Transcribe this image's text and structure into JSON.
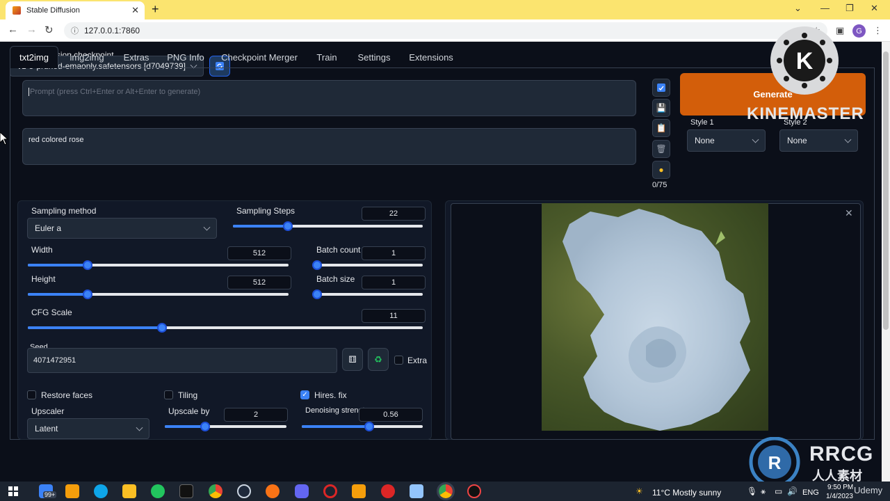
{
  "browser": {
    "tab_title": "Stable Diffusion",
    "url": "127.0.0.1:7860",
    "profile_initial": "G"
  },
  "checkpoint": {
    "label": "Stable Diffusion checkpoint",
    "value": "v1-5-pruned-emaonly.safetensors [d7049739]"
  },
  "tabs": [
    {
      "label": "txt2img",
      "active": true
    },
    {
      "label": "img2img"
    },
    {
      "label": "Extras"
    },
    {
      "label": "PNG Info"
    },
    {
      "label": "Checkpoint Merger"
    },
    {
      "label": "Train"
    },
    {
      "label": "Settings"
    },
    {
      "label": "Extensions"
    }
  ],
  "prompt": {
    "placeholder": "Prompt (press Ctrl+Enter or Alt+Enter to generate)",
    "negative_value": "red colored rose",
    "token_count": "0/75"
  },
  "generate_label": "Generate",
  "styles": {
    "style1_label": "Style 1",
    "style1_value": "None",
    "style2_label": "Style 2",
    "style2_value": "None"
  },
  "settings": {
    "sampling_method_label": "Sampling method",
    "sampling_method_value": "Euler a",
    "sampling_steps_label": "Sampling Steps",
    "sampling_steps_value": "22",
    "sampling_steps_fraction": 0.29,
    "width_label": "Width",
    "width_value": "512",
    "width_fraction": 0.23,
    "height_label": "Height",
    "height_value": "512",
    "height_fraction": 0.23,
    "batch_count_label": "Batch count",
    "batch_count_value": "1",
    "batch_count_fraction": 0.0,
    "batch_size_label": "Batch size",
    "batch_size_value": "1",
    "batch_size_fraction": 0.0,
    "cfg_label": "CFG Scale",
    "cfg_value": "11",
    "cfg_fraction": 0.34,
    "seed_label": "Seed",
    "seed_value": "4071472951",
    "extra_label": "Extra",
    "restore_faces_label": "Restore faces",
    "tiling_label": "Tiling",
    "hires_label": "Hires. fix",
    "upscaler_label": "Upscaler",
    "upscaler_value": "Latent",
    "upscale_by_label": "Upscale by",
    "upscale_by_value": "2",
    "upscale_by_fraction": 0.33,
    "denoise_label": "Denoising strengt",
    "denoise_value": "0.56",
    "denoise_fraction": 0.56
  },
  "watermark": {
    "kinemaster": "KINEMASTER",
    "rrcg": "RRCG",
    "rrcg_sub": "人人素材",
    "udemy": "Udemy"
  },
  "taskbar": {
    "weather": "11°C  Mostly sunny",
    "lang": "ENG",
    "time": "9:50 PM",
    "date": "1/4/2023",
    "badge": "99+"
  },
  "colors": {
    "accent": "#3b82f6",
    "generate": "#d35e0a",
    "background": "#0b0f19"
  }
}
